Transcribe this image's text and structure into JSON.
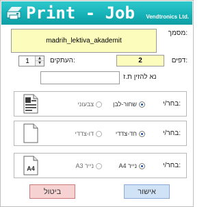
{
  "header": {
    "title": "Print - Job",
    "subtitle": "Vendtronics Ltd."
  },
  "form": {
    "document_label": ":מסמך",
    "document_name": "madrih_lektiva_akademit",
    "pages_label": ":דפים",
    "pages_value": "2",
    "copies_label": ":העתקים",
    "copies_value": "1",
    "id_label": "נא להזין ת.ז",
    "id_value": ""
  },
  "groups": [
    {
      "choose_label": ":בחר/י",
      "options": [
        {
          "label": "שחור-לבן",
          "selected": true
        },
        {
          "label": "צבעוני",
          "selected": false
        }
      ],
      "icon": "color-document-icon"
    },
    {
      "choose_label": ":בחר/י",
      "options": [
        {
          "label": "חד-צדדי",
          "selected": true
        },
        {
          "label": "דו-צדדי",
          "selected": false
        }
      ],
      "icon": "blank-page-icon"
    },
    {
      "choose_label": ":בחר/י",
      "options": [
        {
          "label": "נייר A4",
          "selected": true
        },
        {
          "label": "נייר A3",
          "selected": false
        }
      ],
      "icon": "a4-paper-icon",
      "icon_text": "A4"
    }
  ],
  "buttons": {
    "cancel_label": "ביטול",
    "ok_label": "אישור"
  },
  "colors": {
    "header": "#16b3b8",
    "field_bg": "#fcfcbd",
    "cancel_bg": "#f6d2d2",
    "ok_bg": "#cfe2f6",
    "radio_on": "#1a4fa8"
  }
}
